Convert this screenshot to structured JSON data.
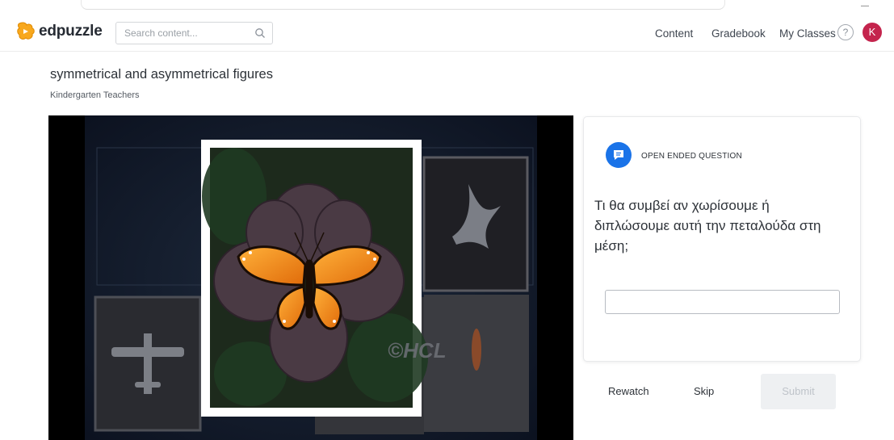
{
  "brand": {
    "name": "edpuzzle",
    "accent": "#f8a81d",
    "icon": "edpuzzle-logo-icon"
  },
  "search": {
    "placeholder": "Search content...",
    "icon": "search-icon"
  },
  "nav": {
    "links": [
      "Content",
      "Gradebook",
      "My Classes"
    ],
    "help_glyph": "?",
    "avatar_letter": "K",
    "avatar_color": "#c4244d"
  },
  "lesson": {
    "title": "symmetrical and asymmetrical figures",
    "owner": "Kindergarten Teachers"
  },
  "video": {
    "watermark": "©HCL",
    "content": "butterfly-symmetry-frame"
  },
  "question": {
    "type_label": "OPEN ENDED QUESTION",
    "type_icon": "comment-icon",
    "type_color": "#1a73e8",
    "text": "Τι θα συμβεί αν χωρίσουμε ή διπλώσουμε αυτή την πεταλούδα στη μέση;",
    "answer_value": ""
  },
  "actions": {
    "rewatch": "Rewatch",
    "skip": "Skip",
    "submit": "Submit"
  }
}
